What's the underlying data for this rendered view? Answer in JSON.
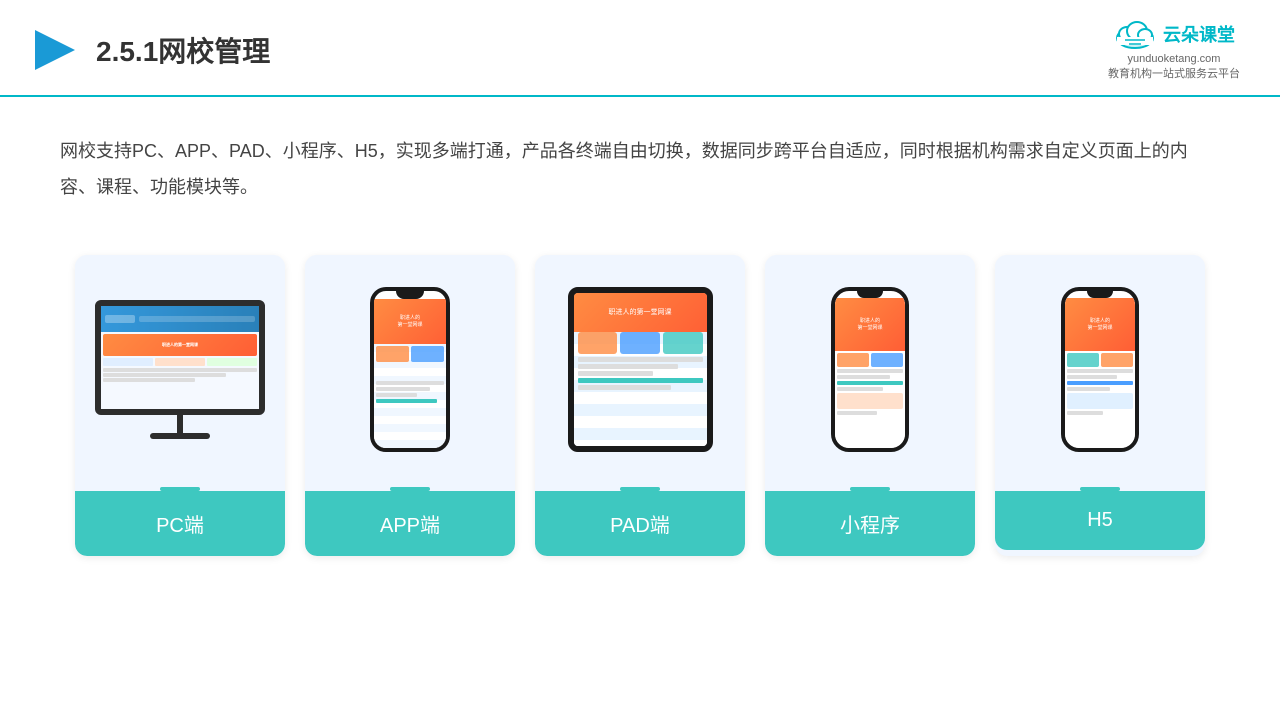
{
  "header": {
    "title": "2.5.1网校管理",
    "logo_text": "云朵课堂",
    "logo_url": "yunduoketang.com",
    "logo_tagline": "教育机构一站\n式服务云平台"
  },
  "description": {
    "text": "网校支持PC、APP、PAD、小程序、H5，实现多端打通，产品各终端自由切换，数据同步跨平台自适应，同时根据机构需求自定义页面上的内容、课程、功能模块等。"
  },
  "cards": [
    {
      "id": "pc",
      "label": "PC端"
    },
    {
      "id": "app",
      "label": "APP端"
    },
    {
      "id": "pad",
      "label": "PAD端"
    },
    {
      "id": "miniprogram",
      "label": "小程序"
    },
    {
      "id": "h5",
      "label": "H5"
    }
  ],
  "colors": {
    "accent": "#3ec8c0",
    "header_border": "#00b8c8",
    "bg_card": "#f0f6ff",
    "text_dark": "#333",
    "text_body": "#444"
  }
}
